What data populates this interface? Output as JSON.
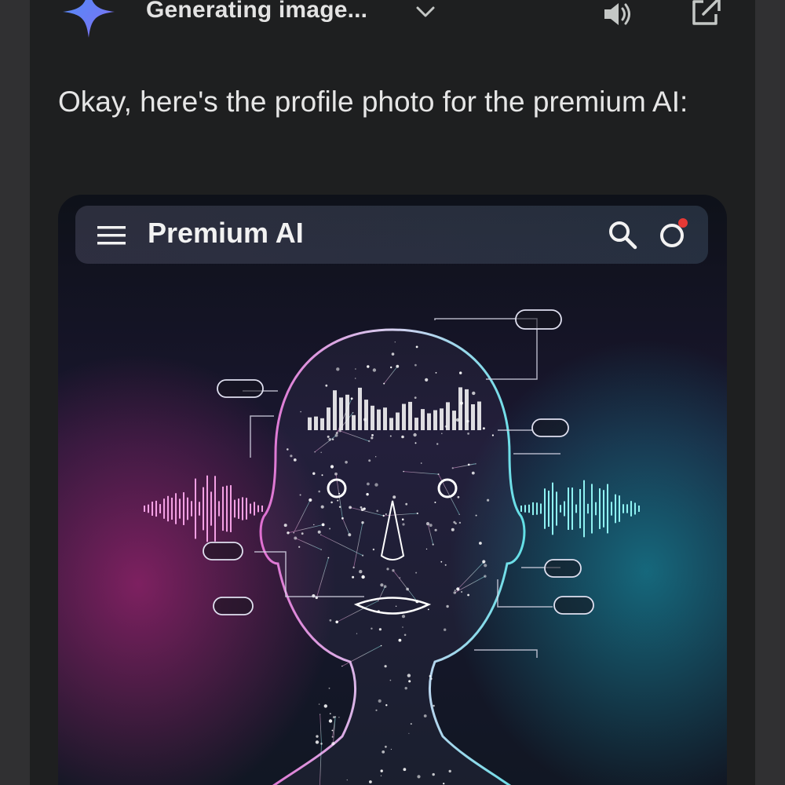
{
  "header": {
    "title": "Generating image...",
    "icons": [
      "gemini-sparkle-icon",
      "chevron-down-icon",
      "speaker-icon",
      "open-external-icon"
    ]
  },
  "message": {
    "text": "Okay, here's the profile photo for the premium AI:"
  },
  "image_card": {
    "app_title": "Premium AI",
    "icons": [
      "hamburger-menu-icon",
      "search-icon",
      "profile-circle-icon"
    ],
    "colors": {
      "left_glow": "#d42a8c",
      "right_glow": "#14aabe",
      "notification_dot": "#e53935"
    }
  }
}
